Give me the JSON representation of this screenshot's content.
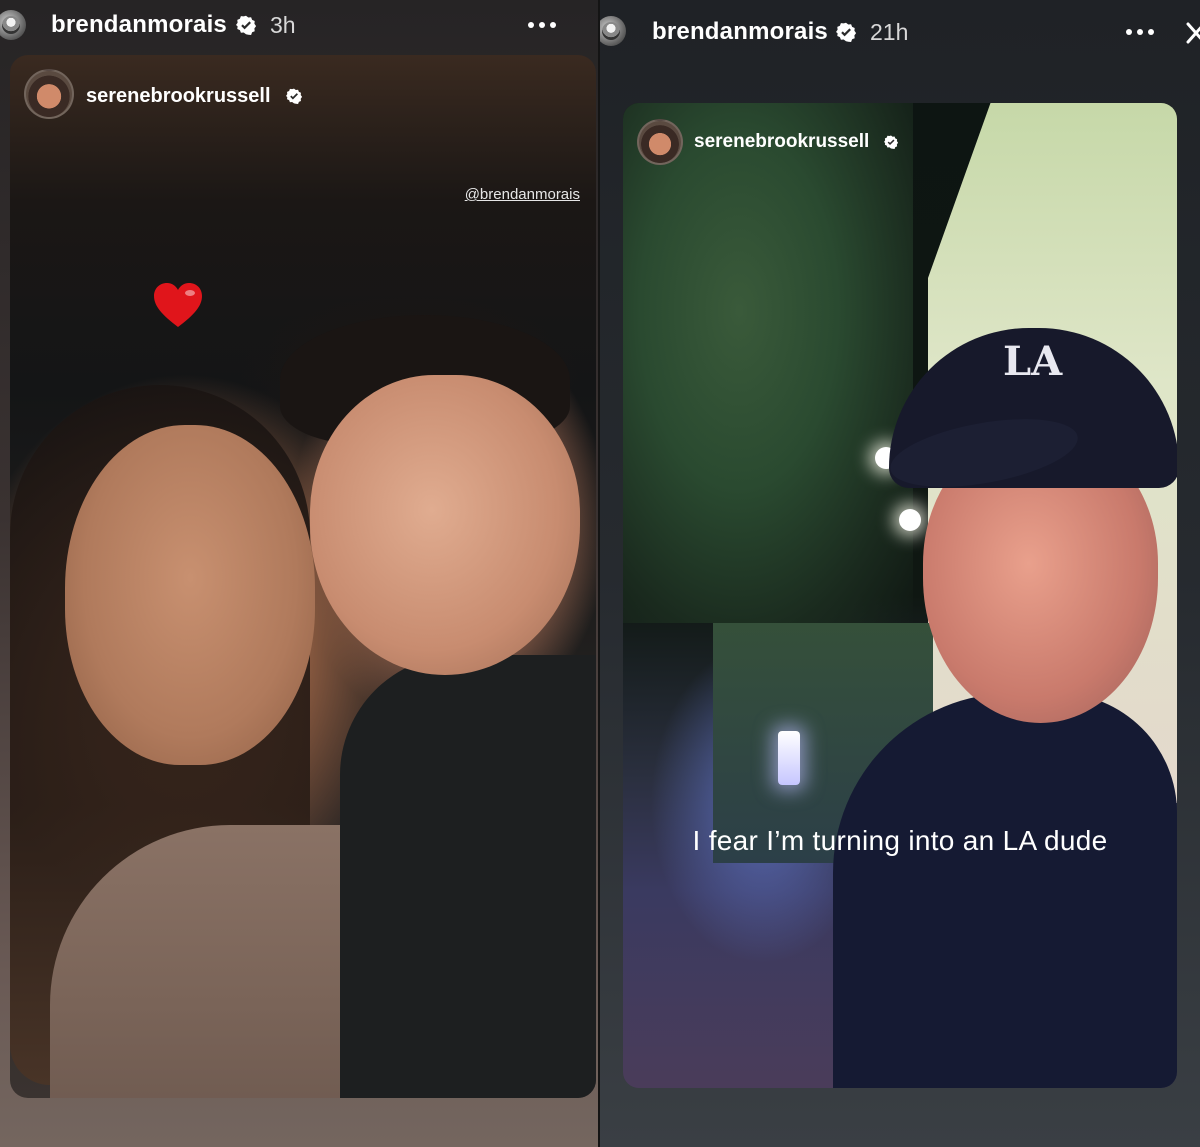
{
  "left_post": {
    "username": "brendanmorais",
    "time": "3h",
    "story": {
      "username": "serenebrookrussell",
      "mention": "@brendanmorais"
    }
  },
  "right_post": {
    "username": "brendanmorais",
    "time": "21h",
    "story": {
      "username": "serenebrookrussell",
      "caption": "I fear I’m turning into an LA dude",
      "cap_logo": "LA"
    }
  },
  "icons": {
    "verified": "verified-badge-icon",
    "more": "more-options-icon",
    "heart": "heart-sticker-icon",
    "close": "close-icon"
  },
  "colors": {
    "verified": "#ffffff",
    "heart": "#e0151b"
  }
}
